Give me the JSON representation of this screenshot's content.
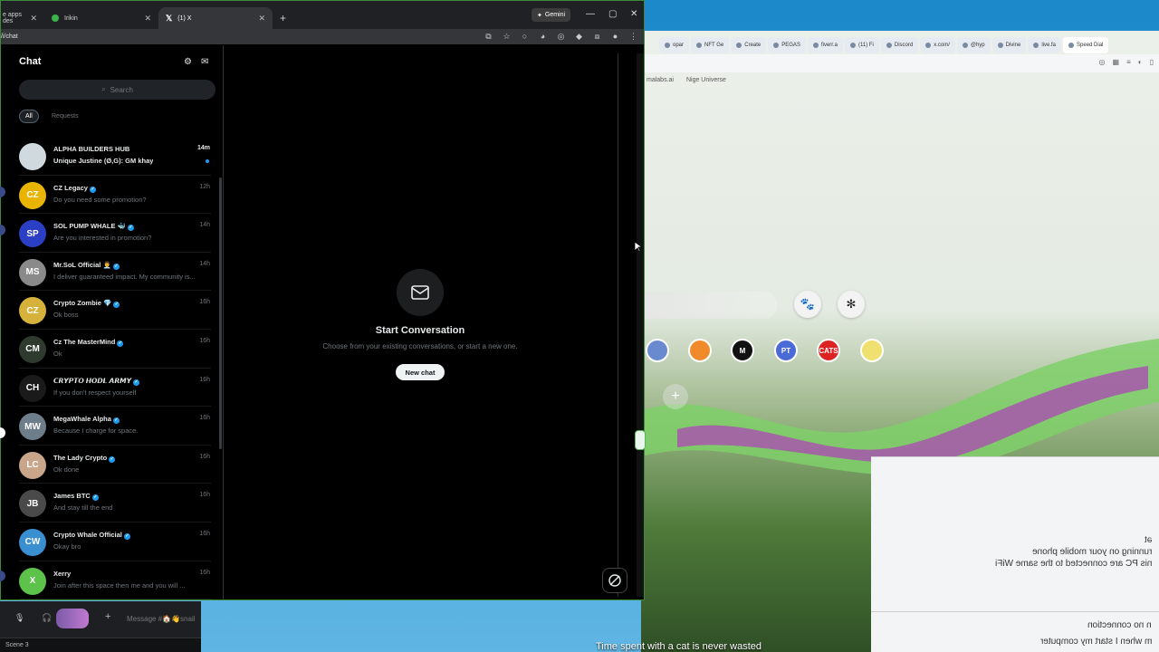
{
  "tabs": [
    {
      "label": "e apps des",
      "favicon_color": "#d9d9d9"
    },
    {
      "label": "Irikin",
      "favicon_color": "#3cb34a"
    },
    {
      "label": "(1) X",
      "favicon_color": "#ffffff"
    }
  ],
  "gemini_label": "Gemini",
  "url": "/i/chat",
  "chat": {
    "title": "Chat",
    "search_placeholder": "Search",
    "filters": {
      "all": "All",
      "requests": "Requests"
    },
    "conversations": [
      {
        "name": "ALPHA BUILDERS HUB",
        "preview": "Unique Justine (Ø,G): GM khay",
        "time": "14m",
        "unread": true,
        "verified": false,
        "avatar_color": "#cfd9de",
        "avatar_text": ""
      },
      {
        "name": "CZ Legacy",
        "preview": "Do you need some promotion?",
        "time": "12h",
        "unread": false,
        "verified": true,
        "avatar_color": "#e8b400",
        "avatar_text": "CZ"
      },
      {
        "name": "SOL PUMP WHALE 🐳",
        "preview": "Are you interested in promotion?",
        "time": "14h",
        "unread": false,
        "verified": true,
        "avatar_color": "#2b3fc4",
        "avatar_text": "SP"
      },
      {
        "name": "Mr.SoL Official 👨‍💼",
        "preview": "I deliver guaranteed impact. My community is...",
        "time": "14h",
        "unread": false,
        "verified": true,
        "avatar_color": "#8a8a8a",
        "avatar_text": "MS"
      },
      {
        "name": "Crypto Zombie 💎",
        "preview": "Ok boss",
        "time": "16h",
        "unread": false,
        "verified": true,
        "avatar_color": "#d6b23a",
        "avatar_text": "CZ"
      },
      {
        "name": "Cz The MasterMind",
        "preview": "Ok",
        "time": "16h",
        "unread": false,
        "verified": true,
        "avatar_color": "#2e3a2e",
        "avatar_text": "CM"
      },
      {
        "name": "𝘾𝙍𝙔𝙋𝙏𝙊 𝙃𝙊𝘿𝙇 𝘼𝙍𝙈𝙔",
        "preview": "If you don't respect yourself",
        "time": "16h",
        "unread": false,
        "verified": true,
        "avatar_color": "#1a1a1a",
        "avatar_text": "CH"
      },
      {
        "name": "MegaWhale Alpha",
        "preview": "Because I charge for space.",
        "time": "16h",
        "unread": false,
        "verified": true,
        "avatar_color": "#6e7d8a",
        "avatar_text": "MW"
      },
      {
        "name": "The Lady Crypto",
        "preview": "Ok done",
        "time": "16h",
        "unread": false,
        "verified": true,
        "avatar_color": "#c9a58a",
        "avatar_text": "LC"
      },
      {
        "name": "James BTC",
        "preview": "And stay till the end",
        "time": "16h",
        "unread": false,
        "verified": true,
        "avatar_color": "#4a4a4a",
        "avatar_text": "JB"
      },
      {
        "name": "Crypto Whale Official",
        "preview": "Okay bro",
        "time": "16h",
        "unread": false,
        "verified": true,
        "avatar_color": "#3a8fd0",
        "avatar_text": "CW"
      },
      {
        "name": "Xerry",
        "preview": "Join after this space then me and you will ...",
        "time": "16h",
        "unread": false,
        "verified": false,
        "avatar_color": "#5cc24a",
        "avatar_text": "X"
      }
    ]
  },
  "empty_state": {
    "title": "Start Conversation",
    "subtitle": "Choose from your existing conversations, or start a new one.",
    "button": "New chat"
  },
  "bg_browser": {
    "tabs": [
      "opar",
      "NFT Ge",
      "Create",
      "PEGAS",
      "fiverr.a",
      "(11) Fi",
      "Discord",
      "x.com/",
      "@hyp",
      "Divine",
      "live.fa",
      "Speed Dial"
    ],
    "bookmarks": [
      "malabs.ai",
      "Nige Universe"
    ],
    "speed_dial": [
      "",
      "",
      "M",
      "PT",
      "CATS",
      ""
    ],
    "dialog_lines": [
      "ət",
      "running on your mobile phone",
      "nis PC are connected to the same WiFi",
      "n no connection",
      "m when I start my computer"
    ],
    "caption": "Time spent with a cat is never wasted"
  },
  "bottom_bar": {
    "message_placeholder": "Message #🏠👋snail",
    "scene_label": "Scene 3"
  }
}
